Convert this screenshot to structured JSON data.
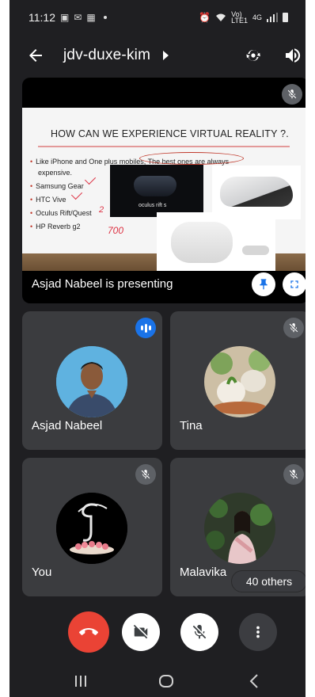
{
  "status_bar": {
    "time": "11:12",
    "network_label_top": "Vo)",
    "network_label_mid": "LTE1",
    "network_label_small": "4G"
  },
  "app_bar": {
    "meeting_code": "jdv-duxe-kim",
    "icons": [
      "back-arrow-icon",
      "caret-right-icon",
      "switch-camera-icon",
      "speaker-icon"
    ]
  },
  "presentation": {
    "presenter_label": "Asjad Nabeel is presenting",
    "slide": {
      "title": "HOW CAN WE EXPERIENCE VIRTUAL REALITY ?.",
      "bullets": [
        "Like iPhone and One plus mobiles, The best ones are always",
        "expensive.",
        "Samsung Gear",
        "HTC Vive",
        "Oculus Rift/Quest",
        "HP Reverb g2"
      ],
      "image_caption": "oculus rift s",
      "annotation_2": "2",
      "annotation_700": "700"
    }
  },
  "participants": [
    {
      "name": "Asjad Nabeel",
      "status": "speaking"
    },
    {
      "name": "Tina",
      "status": "muted"
    },
    {
      "name": "You",
      "status": "muted"
    },
    {
      "name": "Malavika",
      "status": "muted"
    }
  ],
  "others_count_label": "40 others",
  "colors": {
    "background": "#1f1f22",
    "tile": "#3b3c3f",
    "end_call": "#ea4335",
    "speaking_badge": "#1a73e8",
    "muted_badge": "#5e6166"
  }
}
